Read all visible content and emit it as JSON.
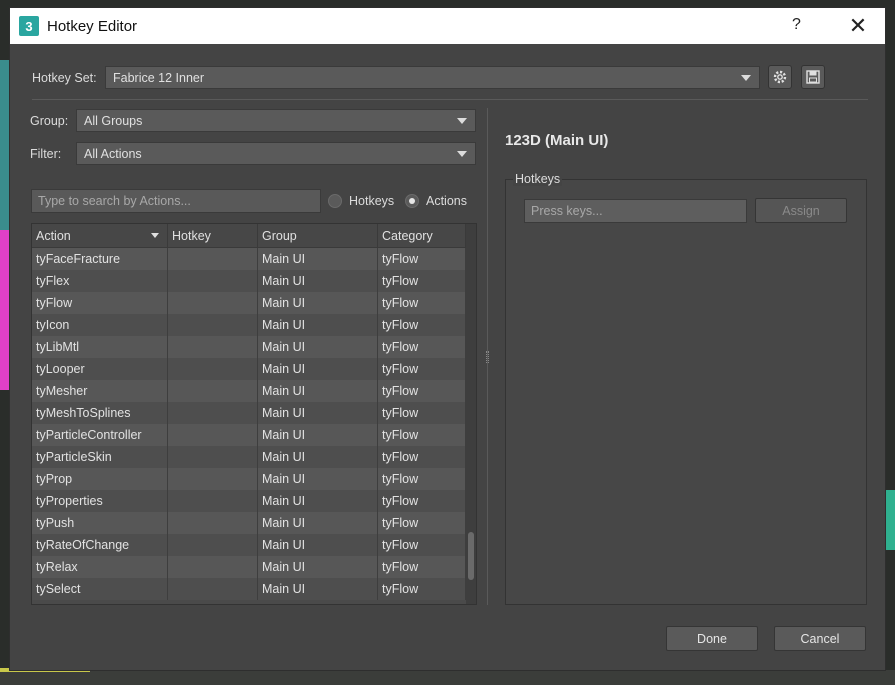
{
  "window": {
    "title": "Hotkey Editor",
    "app_icon_label": "3",
    "help_label": "?",
    "close_label": "✕"
  },
  "hotkey_set": {
    "label": "Hotkey Set:",
    "value": "Fabrice 12 Inner"
  },
  "filters": {
    "group_label": "Group:",
    "group_value": "All Groups",
    "filter_label": "Filter:",
    "filter_value": "All Actions"
  },
  "search": {
    "placeholder": "Type to search by Actions...",
    "radio_hotkeys": "Hotkeys",
    "radio_actions": "Actions",
    "selected": "Actions"
  },
  "table": {
    "columns": [
      "Action",
      "Hotkey",
      "Group",
      "Category"
    ],
    "rows": [
      {
        "action": "tyFaceFracture",
        "hotkey": "",
        "group": "Main UI",
        "category": "tyFlow"
      },
      {
        "action": "tyFlex",
        "hotkey": "",
        "group": "Main UI",
        "category": "tyFlow"
      },
      {
        "action": "tyFlow",
        "hotkey": "",
        "group": "Main UI",
        "category": "tyFlow"
      },
      {
        "action": "tyIcon",
        "hotkey": "",
        "group": "Main UI",
        "category": "tyFlow"
      },
      {
        "action": "tyLibMtl",
        "hotkey": "",
        "group": "Main UI",
        "category": "tyFlow"
      },
      {
        "action": "tyLooper",
        "hotkey": "",
        "group": "Main UI",
        "category": "tyFlow"
      },
      {
        "action": "tyMesher",
        "hotkey": "",
        "group": "Main UI",
        "category": "tyFlow"
      },
      {
        "action": "tyMeshToSplines",
        "hotkey": "",
        "group": "Main UI",
        "category": "tyFlow"
      },
      {
        "action": "tyParticleController",
        "hotkey": "",
        "group": "Main UI",
        "category": "tyFlow"
      },
      {
        "action": "tyParticleSkin",
        "hotkey": "",
        "group": "Main UI",
        "category": "tyFlow"
      },
      {
        "action": "tyProp",
        "hotkey": "",
        "group": "Main UI",
        "category": "tyFlow"
      },
      {
        "action": "tyProperties",
        "hotkey": "",
        "group": "Main UI",
        "category": "tyFlow"
      },
      {
        "action": "tyPush",
        "hotkey": "",
        "group": "Main UI",
        "category": "tyFlow"
      },
      {
        "action": "tyRateOfChange",
        "hotkey": "",
        "group": "Main UI",
        "category": "tyFlow"
      },
      {
        "action": "tyRelax",
        "hotkey": "",
        "group": "Main UI",
        "category": "tyFlow"
      },
      {
        "action": "tySelect",
        "hotkey": "",
        "group": "Main UI",
        "category": "tyFlow"
      }
    ]
  },
  "details": {
    "title": "123D (Main UI)",
    "hotkeys_group_label": "Hotkeys",
    "press_keys_placeholder": "Press keys...",
    "assign_label": "Assign"
  },
  "footer": {
    "done_label": "Done",
    "cancel_label": "Cancel"
  }
}
